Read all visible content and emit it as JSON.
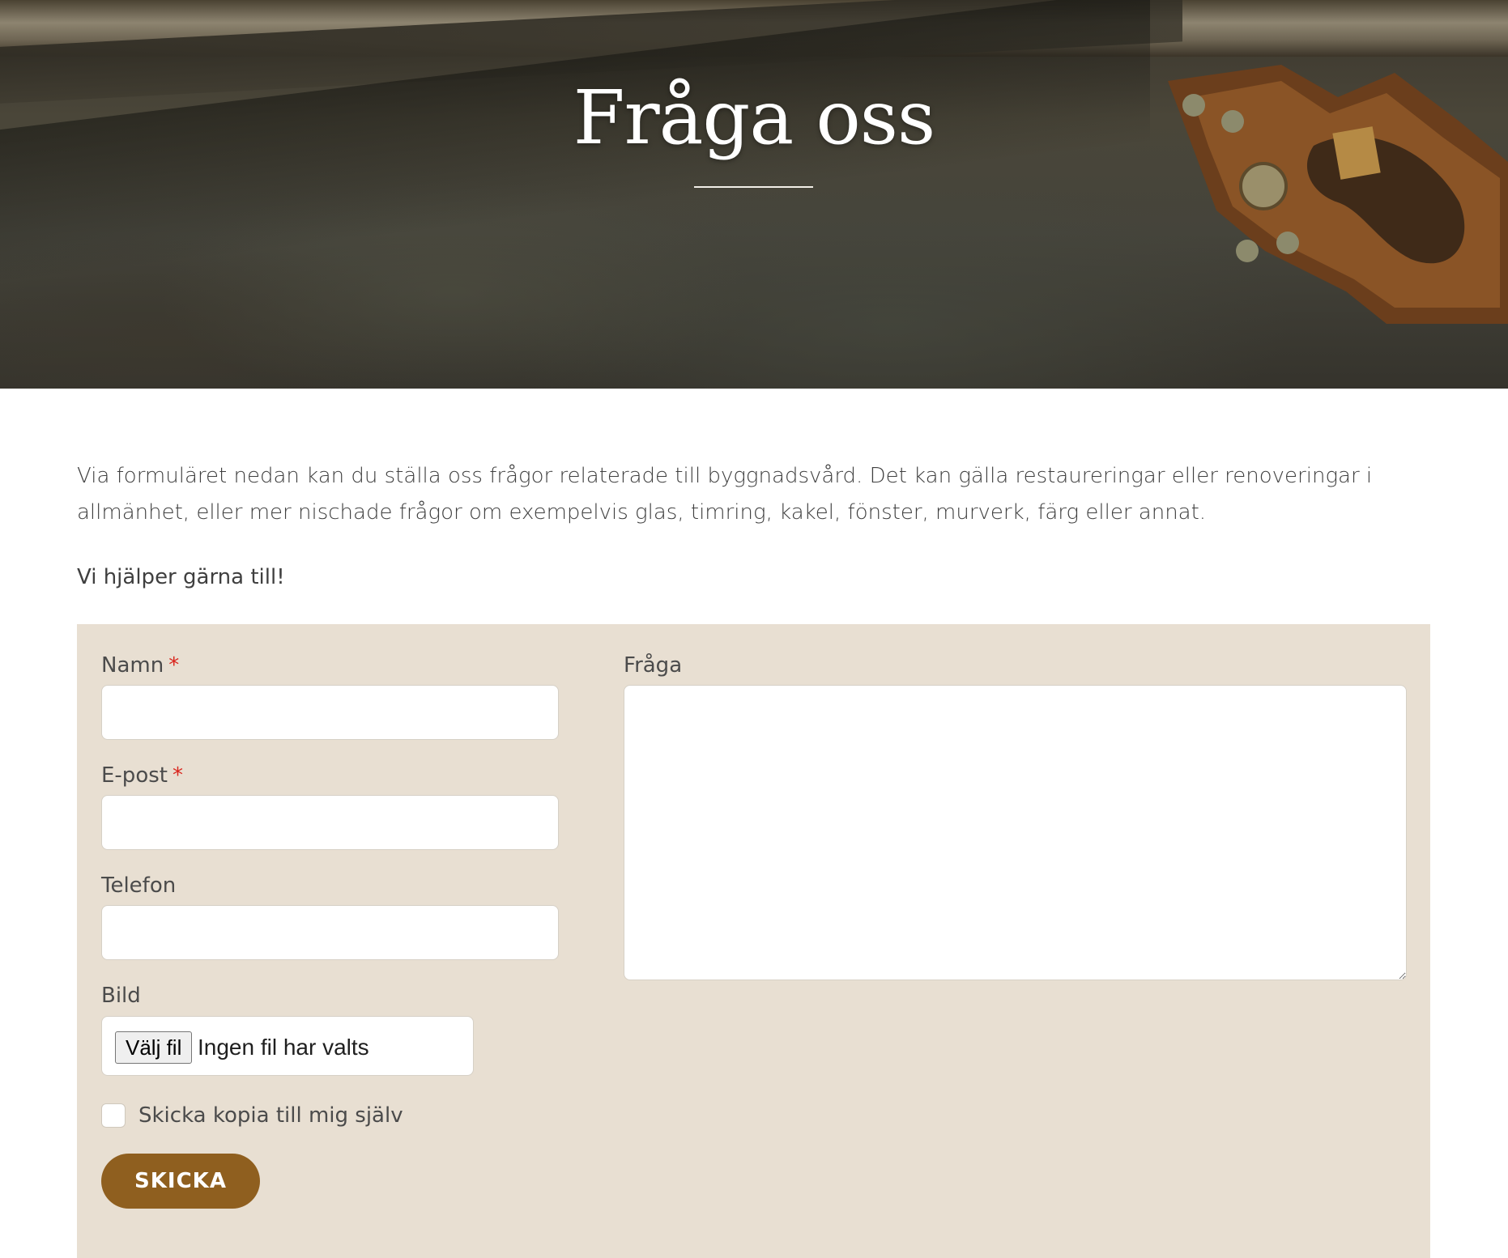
{
  "hero": {
    "title": "Fråga oss"
  },
  "intro": {
    "paragraph": "Via formuläret nedan kan du ställa oss frågor relaterade till byggnadsvård. Det kan gälla restaureringar eller renoveringar i allmänhet, eller mer nischade frågor om exempelvis glas, timring, kakel, fönster, murverk, färg eller annat.",
    "tagline": "Vi hjälper gärna till!"
  },
  "form": {
    "name_label": "Namn",
    "email_label": "E-post",
    "phone_label": "Telefon",
    "image_label": "Bild",
    "question_label": "Fråga",
    "required_marker": "*",
    "name_value": "",
    "email_value": "",
    "phone_value": "",
    "question_value": "",
    "file_button_label": "Välj fil",
    "file_status": "Ingen fil har valts",
    "copy_checkbox_label": "Skicka kopia till mig själv",
    "copy_checked": false,
    "submit_label": "SKICKA"
  },
  "colors": {
    "form_background": "#e8dfd2",
    "submit_button": "#8f5f1f",
    "required_marker": "#d9251d"
  },
  "icons": {
    "resize_handle": "resize-grip-icon"
  }
}
